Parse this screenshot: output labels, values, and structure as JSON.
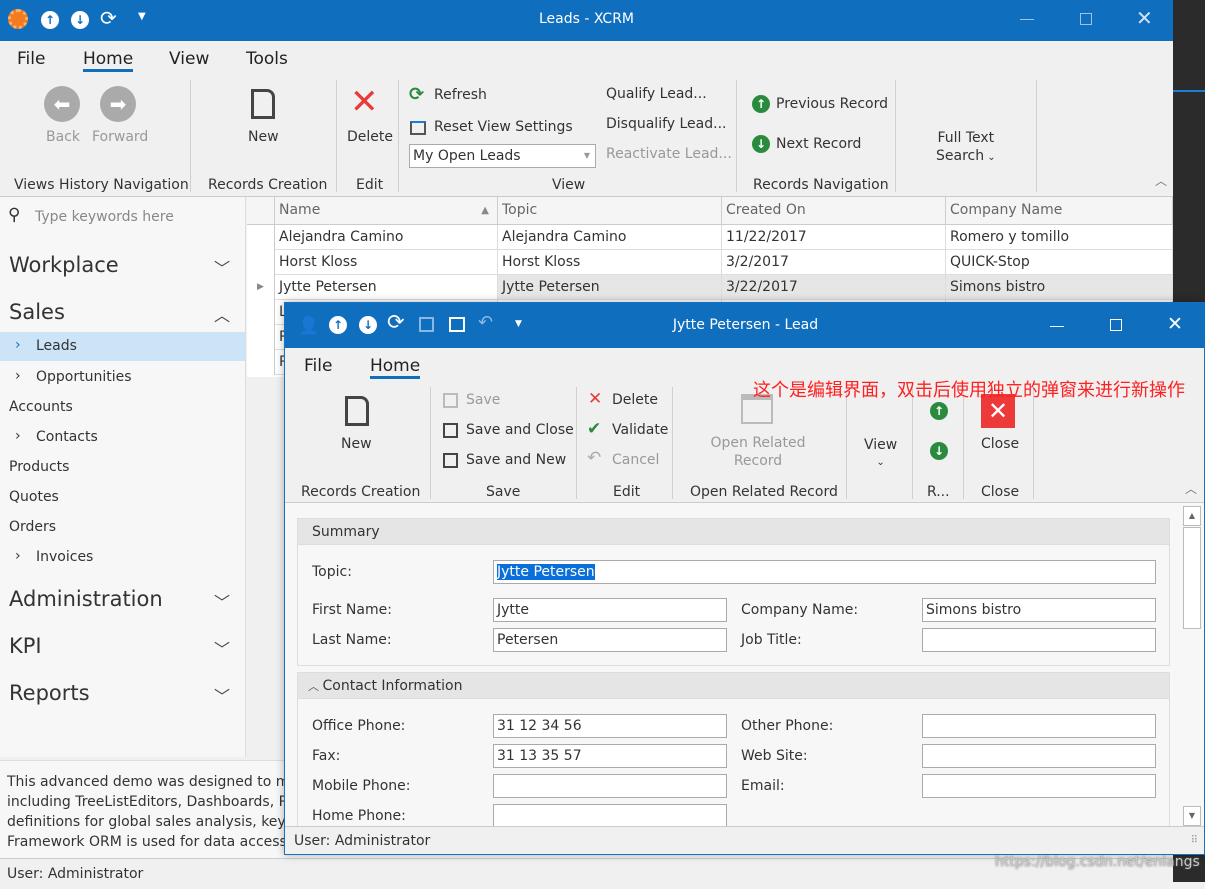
{
  "main": {
    "title": "Leads - XCRM",
    "qat_icons": [
      "app-gear-icon",
      "arrow-up-icon",
      "arrow-down-icon",
      "refresh-icon",
      "dropdown-icon"
    ],
    "tabs": [
      "File",
      "Home",
      "View",
      "Tools"
    ],
    "active_tab": "Home",
    "ribbon": {
      "back": "Back",
      "forward": "Forward",
      "views_history_group": "Views History Navigation",
      "new": "New",
      "records_creation_group": "Records Creation",
      "delete": "Delete",
      "edit_group": "Edit",
      "refresh": "Refresh",
      "reset_view": "Reset View Settings",
      "view_select": "My Open Leads",
      "qualify": "Qualify Lead...",
      "disqualify": "Disqualify Lead...",
      "reactivate": "Reactivate Lead...",
      "view_group": "View",
      "previous_record": "Previous Record",
      "next_record": "Next Record",
      "records_nav_group": "Records Navigation",
      "full_text_search_1": "Full Text",
      "full_text_search_2": "Search"
    },
    "search_placeholder": "Type keywords here",
    "nav": {
      "workplace": "Workplace",
      "sales": "Sales",
      "sales_items": [
        "Leads",
        "Opportunities",
        "Accounts",
        "Contacts",
        "Products",
        "Quotes",
        "Orders",
        "Invoices"
      ],
      "selected": "Leads",
      "administration": "Administration",
      "kpi": "KPI",
      "reports": "Reports"
    },
    "description": [
      "This advanced demo was designed to mir",
      "including TreeListEditors, Dashboards, Pive",
      "definitions for global sales analysis, key pe",
      "Framework ORM is used for data access."
    ],
    "status": "User: Administrator",
    "grid": {
      "columns": [
        "Name",
        "Topic",
        "Created On",
        "Company Name"
      ],
      "sort": "Name ascending",
      "rows": [
        [
          "Alejandra Camino",
          "Alejandra Camino",
          "11/22/2017",
          "Romero y tomillo"
        ],
        [
          "Horst Kloss",
          "Horst Kloss",
          "3/2/2017",
          "QUICK-Stop"
        ],
        [
          "Jytte Petersen",
          "Jytte Petersen",
          "3/22/2017",
          "Simons bistro"
        ],
        [
          "L",
          "",
          "",
          ""
        ],
        [
          "P",
          "",
          "",
          ""
        ],
        [
          "P",
          "",
          "",
          ""
        ]
      ],
      "focused_row": 2
    }
  },
  "popup": {
    "title": "Jytte Petersen - Lead",
    "tabs": [
      "File",
      "Home"
    ],
    "ribbon": {
      "new": "New",
      "records_creation_group": "Records Creation",
      "save": "Save",
      "save_close": "Save and Close",
      "save_new": "Save and New",
      "save_group": "Save",
      "delete": "Delete",
      "validate": "Validate",
      "cancel": "Cancel",
      "edit_group": "Edit",
      "open_related_1": "Open Related",
      "open_related_2": "Record",
      "open_related_group": "Open Related Record",
      "view": "View",
      "r_group": "R...",
      "close": "Close",
      "close_group": "Close"
    },
    "annotation": "这个是编辑界面，双击后使用独立的弹窗来进行新操作",
    "summary": {
      "header": "Summary",
      "topic_label": "Topic:",
      "topic": "Jytte Petersen",
      "first_name_label": "First Name:",
      "first_name": "Jytte",
      "last_name_label": "Last Name:",
      "last_name": "Petersen",
      "company_label": "Company Name:",
      "company": "Simons bistro",
      "job_title_label": "Job Title:",
      "job_title": ""
    },
    "contact": {
      "header": "Contact Information",
      "office_phone_label": "Office Phone:",
      "office_phone": "31 12 34 56",
      "fax_label": "Fax:",
      "fax": "31 13 35 57",
      "mobile_label": "Mobile Phone:",
      "mobile": "",
      "home_label": "Home Phone:",
      "home": "",
      "other_label": "Other Phone:",
      "other": "",
      "web_label": "Web Site:",
      "web": "",
      "email_label": "Email:",
      "email": ""
    },
    "status": "User: Administrator"
  },
  "watermark": "https://blog.csdn.net/enlangs",
  "colors": {
    "accent": "#106ebe",
    "delete": "#e83a3a",
    "nav_green": "#2a8a3e",
    "selection": "#cce4f7",
    "annotation": "#ff2020"
  }
}
